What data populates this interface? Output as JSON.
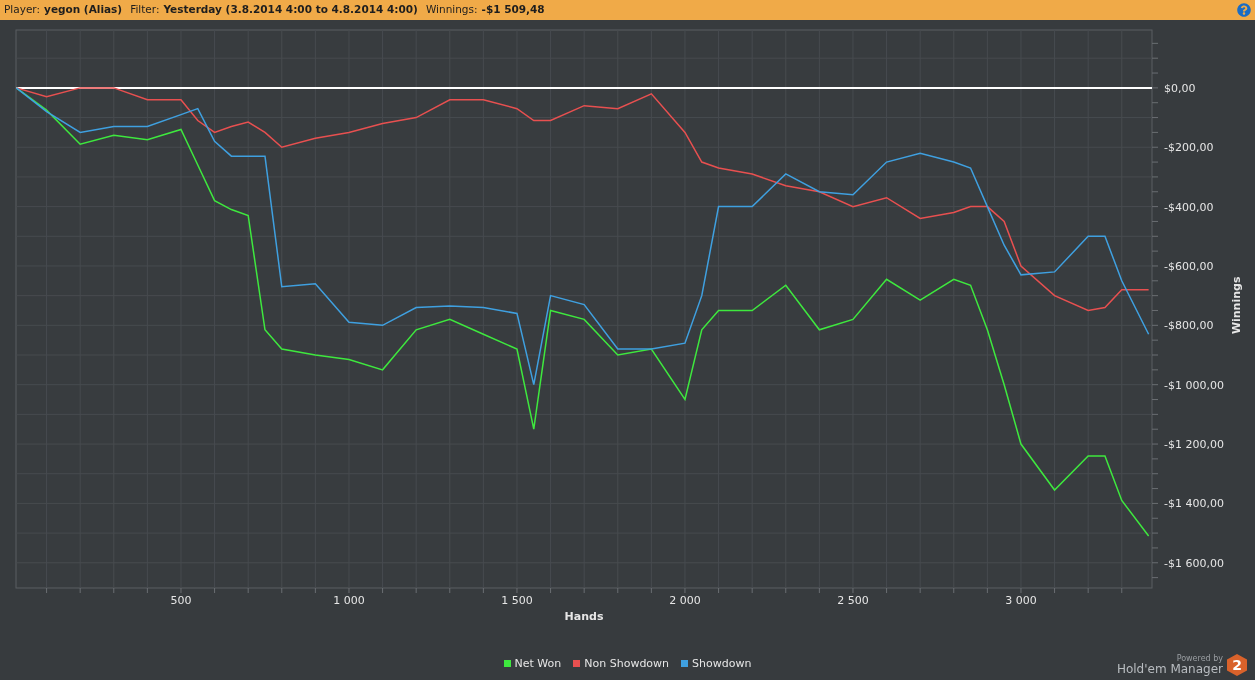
{
  "header": {
    "fields": [
      {
        "label": "Player:",
        "value": "yegon (Alias)"
      },
      {
        "label": "Filter:",
        "value": "Yesterday (3.8.2014 4:00 to 4.8.2014 4:00)"
      },
      {
        "label": "Winnings:",
        "value": "-$1 509,48"
      }
    ]
  },
  "chart": {
    "chart_data": {
      "type": "line",
      "xlabel": "Hands",
      "ylabel": "Winnings",
      "x": [
        10,
        100,
        200,
        300,
        400,
        500,
        550,
        600,
        650,
        700,
        750,
        800,
        900,
        1000,
        1100,
        1200,
        1300,
        1400,
        1500,
        1550,
        1600,
        1700,
        1800,
        1900,
        2000,
        2050,
        2100,
        2200,
        2300,
        2400,
        2500,
        2600,
        2700,
        2800,
        2850,
        2900,
        2950,
        3000,
        3100,
        3200,
        3250,
        3300,
        3380
      ],
      "series": [
        {
          "name": "Net Won",
          "color": "#3ee83e",
          "values": [
            0,
            -75,
            -190,
            -160,
            -175,
            -140,
            -260,
            -380,
            -410,
            -430,
            -815,
            -880,
            -900,
            -915,
            -950,
            -815,
            -780,
            -830,
            -880,
            -1150,
            -750,
            -780,
            -900,
            -880,
            -1050,
            -815,
            -750,
            -750,
            -665,
            -815,
            -780,
            -645,
            -715,
            -645,
            -665,
            -815,
            -1000,
            -1200,
            -1355,
            -1240,
            -1240,
            -1390,
            -1510
          ]
        },
        {
          "name": "Non Showdown",
          "color": "#e85050",
          "values": [
            0,
            -30,
            0,
            0,
            -40,
            -40,
            -110,
            -150,
            -130,
            -115,
            -150,
            -200,
            -170,
            -150,
            -120,
            -100,
            -40,
            -40,
            -70,
            -110,
            -110,
            -60,
            -70,
            -20,
            -150,
            -250,
            -270,
            -290,
            -330,
            -350,
            -400,
            -370,
            -440,
            -420,
            -400,
            -400,
            -450,
            -600,
            -700,
            -750,
            -740,
            -680,
            -680
          ]
        },
        {
          "name": "Showdown",
          "color": "#3fa0e0",
          "values": [
            0,
            -80,
            -150,
            -130,
            -130,
            -90,
            -70,
            -180,
            -230,
            -230,
            -230,
            -670,
            -660,
            -790,
            -800,
            -740,
            -735,
            -740,
            -760,
            -1000,
            -700,
            -730,
            -880,
            -880,
            -860,
            -700,
            -400,
            -400,
            -290,
            -350,
            -360,
            -250,
            -220,
            -250,
            -270,
            -400,
            -530,
            -630,
            -620,
            -500,
            -500,
            -650,
            -830
          ]
        }
      ],
      "grid": true,
      "xlim": [
        9,
        3390
      ],
      "ylim": [
        -1685,
        195
      ],
      "xticks": [
        {
          "value": 500,
          "label": "500"
        },
        {
          "value": 1000,
          "label": "1 000"
        },
        {
          "value": 1500,
          "label": "1 500"
        },
        {
          "value": 2000,
          "label": "2 000"
        },
        {
          "value": 2500,
          "label": "2 500"
        },
        {
          "value": 3000,
          "label": "3 000"
        }
      ],
      "yticks": [
        {
          "value": 0,
          "label": "$0,00"
        },
        {
          "value": -200,
          "label": "-$200,00"
        },
        {
          "value": -400,
          "label": "-$400,00"
        },
        {
          "value": -600,
          "label": "-$600,00"
        },
        {
          "value": -800,
          "label": "-$800,00"
        },
        {
          "value": -1000,
          "label": "-$1 000,00"
        },
        {
          "value": -1200,
          "label": "-$1 200,00"
        },
        {
          "value": -1400,
          "label": "-$1 400,00"
        },
        {
          "value": -1600,
          "label": "-$1 600,00"
        }
      ]
    }
  },
  "logo": {
    "powered_by": "Powered by",
    "name": "Hold'em Manager",
    "badge": "2"
  }
}
